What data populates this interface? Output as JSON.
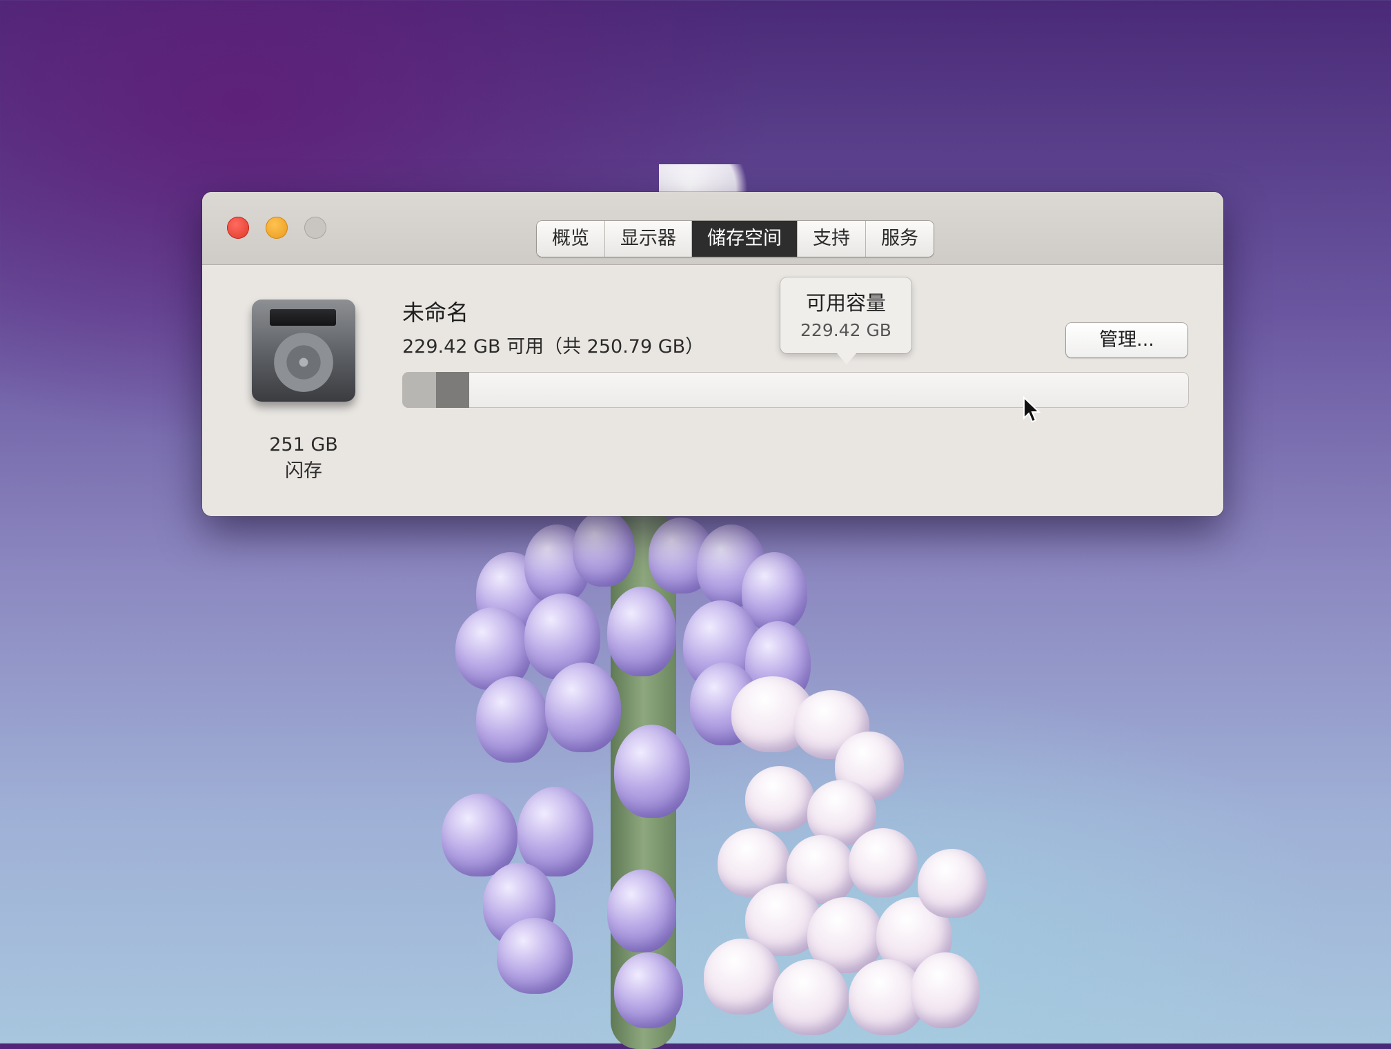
{
  "window": {
    "tabs": [
      {
        "label": "概览"
      },
      {
        "label": "显示器"
      },
      {
        "label": "储存空间"
      },
      {
        "label": "支持"
      },
      {
        "label": "服务"
      }
    ],
    "active_tab": "储存空间"
  },
  "storage": {
    "disk_capacity": "251 GB",
    "disk_type": "闪存",
    "volume_name": "未命名",
    "free_summary": "229.42 GB 可用（共 250.79 GB）",
    "used_fraction": 0.085,
    "tooltip": {
      "title": "可用容量",
      "value": "229.42 GB"
    },
    "manage_label": "管理..."
  },
  "colors": {
    "close": "#e0372a",
    "minimize": "#e89a1d",
    "zoom_disabled": "#c9c5c1",
    "active_tab": "#2d2d2d"
  },
  "icons": [
    "hard-disk-icon",
    "mouse-pointer-icon"
  ]
}
